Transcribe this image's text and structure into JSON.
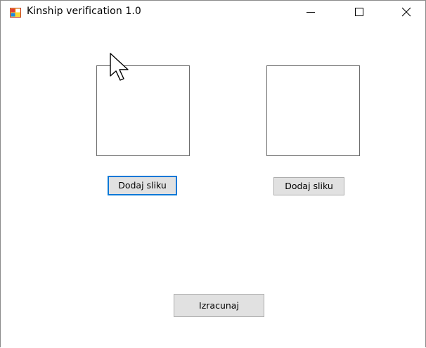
{
  "window": {
    "title": "Kinship verification 1.0"
  },
  "title_bar_buttons": {
    "minimize_icon": "minimize-icon",
    "maximize_icon": "maximize-icon",
    "close_icon": "close-icon"
  },
  "left_panel": {
    "add_button_label": "Dodaj sliku"
  },
  "right_panel": {
    "add_button_label": "Dodaj sliku"
  },
  "actions": {
    "calculate_label": "Izracunaj"
  },
  "colors": {
    "focus_border": "#0078d7",
    "button_face": "#e1e1e1",
    "button_border": "#adadad",
    "picture_box_border": "#6d6d6d"
  }
}
